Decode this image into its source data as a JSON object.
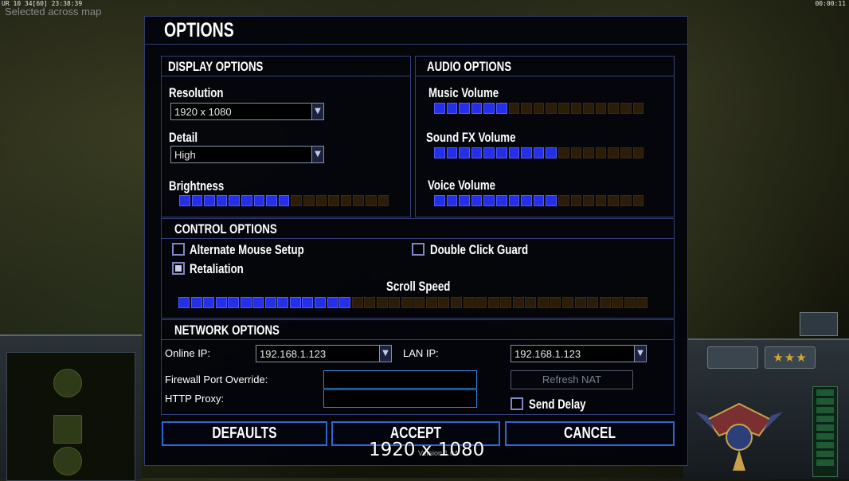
{
  "hud": {
    "top_left_stats": "UR 10 34[60] 23:38:39",
    "selected_hint": "Selected across map",
    "top_right_timer": "00:00:11",
    "rank_stars": "★★★",
    "resolution_overlay": "1920 x 1080"
  },
  "window": {
    "title": "OPTIONS",
    "version": "Version 1.04"
  },
  "display": {
    "title": "DISPLAY OPTIONS",
    "resolution_label": "Resolution",
    "resolution_value": "1920 x 1080",
    "detail_label": "Detail",
    "detail_value": "High",
    "brightness_label": "Brightness",
    "brightness_level": {
      "filled": 9,
      "total": 17
    }
  },
  "audio": {
    "title": "AUDIO OPTIONS",
    "music_label": "Music Volume",
    "music_level": {
      "filled": 6,
      "total": 17
    },
    "sfx_label": "Sound FX Volume",
    "sfx_level": {
      "filled": 10,
      "total": 17
    },
    "voice_label": "Voice Volume",
    "voice_level": {
      "filled": 10,
      "total": 17
    }
  },
  "control": {
    "title": "CONTROL OPTIONS",
    "alt_mouse_label": "Alternate Mouse Setup",
    "alt_mouse_checked": false,
    "double_click_label": "Double Click Guard",
    "double_click_checked": false,
    "retaliation_label": "Retaliation",
    "retaliation_checked": true,
    "scroll_label": "Scroll Speed",
    "scroll_level": {
      "filled": 14,
      "total": 38
    }
  },
  "network": {
    "title": "NETWORK OPTIONS",
    "online_ip_label": "Online IP:",
    "online_ip_value": "192.168.1.123",
    "lan_ip_label": "LAN IP:",
    "lan_ip_value": "192.168.1.123",
    "firewall_label": "Firewall Port Override:",
    "firewall_value": "",
    "proxy_label": "HTTP Proxy:",
    "proxy_value": "",
    "refresh_nat_label": "Refresh NAT",
    "send_delay_label": "Send Delay",
    "send_delay_checked": false
  },
  "buttons": {
    "defaults": "DEFAULTS",
    "accept": "ACCEPT",
    "cancel": "CANCEL"
  }
}
